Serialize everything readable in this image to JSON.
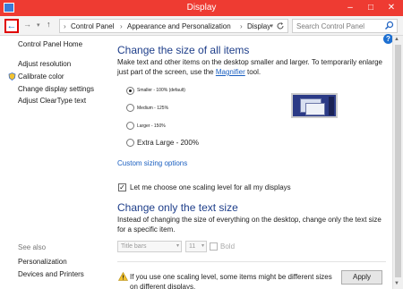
{
  "window": {
    "title": "Display",
    "colors": {
      "titlebar": "#ee3b32",
      "link": "#1a5fc0",
      "heading": "#1e3e8a"
    }
  },
  "titlebar": {
    "minimize": "–",
    "maximize": "□",
    "close": "✕"
  },
  "nav": {
    "back": "←",
    "forward": "→",
    "recent": "▾",
    "up": "↑",
    "path": [
      "Control Panel",
      "Appearance and Personalization",
      "Display"
    ],
    "separator": "›",
    "search_placeholder": "Search Control Panel"
  },
  "sidebar": {
    "home": "Control Panel Home",
    "items": [
      "Adjust resolution",
      "Calibrate color",
      "Change display settings",
      "Adjust ClearType text"
    ],
    "see_also_title": "See also",
    "see_also": [
      "Personalization",
      "Devices and Printers"
    ]
  },
  "main": {
    "section1": {
      "title": "Change the size of all items",
      "desc_1": "Make text and other items on the desktop smaller and larger. To temporarily enlarge just part of the screen, use the",
      "magnifier": "Magnifier",
      "desc_2": "tool.",
      "options": [
        {
          "label": "Smaller - 100% (default)",
          "selected": true
        },
        {
          "label": "Medium - 125%",
          "selected": false
        },
        {
          "label": "Larger - 150%",
          "selected": false
        },
        {
          "label": "Extra Large - 200%",
          "selected": false
        }
      ],
      "custom_link": "Custom sizing options",
      "scaling_checkbox": "Let me choose one scaling level for all my displays",
      "scaling_checked": true
    },
    "section2": {
      "title": "Change only the text size",
      "desc": "Instead of changing the size of everything on the desktop, change only the text size for a specific item.",
      "item_select": "Title bars",
      "size_select": "11",
      "bold_label": "Bold",
      "bold_checked": false
    },
    "warning": "If you use one scaling level, some items might be different sizes on different displays.",
    "apply": "Apply"
  },
  "icons": [
    "window-icon",
    "back-icon",
    "forward-icon",
    "recent-pages-icon",
    "up-icon",
    "refresh-icon",
    "search-icon",
    "help-icon",
    "shield-icon",
    "warning-icon",
    "display-preview-icon"
  ]
}
